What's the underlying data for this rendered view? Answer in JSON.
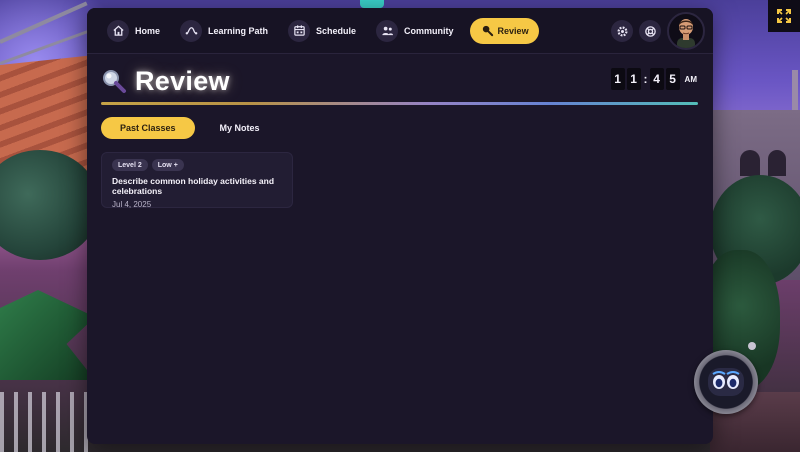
{
  "nav": {
    "items": [
      {
        "label": "Home",
        "icon": "home-icon"
      },
      {
        "label": "Learning Path",
        "icon": "path-icon"
      },
      {
        "label": "Schedule",
        "icon": "calendar-icon"
      },
      {
        "label": "Community",
        "icon": "people-icon"
      },
      {
        "label": "Review",
        "icon": "magnifier-icon",
        "active": true
      }
    ],
    "right_icons": [
      "gear-icon",
      "lifebuoy-icon"
    ],
    "avatar": "user-avatar"
  },
  "page": {
    "title": "Review",
    "title_icon": "magnifier-icon"
  },
  "clock": {
    "digits": [
      "1",
      "1",
      "4",
      "5"
    ],
    "separator": ":",
    "period": "AM"
  },
  "tabs": [
    {
      "label": "Past Classes",
      "active": true
    },
    {
      "label": "My Notes",
      "active": false
    }
  ],
  "classes": [
    {
      "tags": [
        "Level 2",
        "Low +"
      ],
      "title": "Describe common holiday activities and celebrations",
      "date": "Jul 4, 2025"
    }
  ],
  "colors": {
    "accent": "#f6c845",
    "panel": "#1b1629",
    "card": "#221d33"
  }
}
